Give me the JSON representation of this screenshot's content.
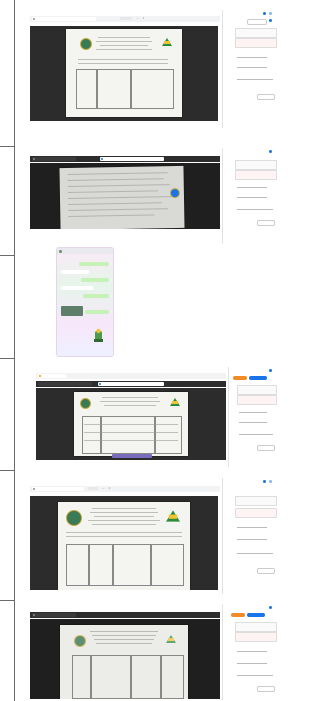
{
  "panels": [
    {
      "id": "p1",
      "title": "",
      "tab": "",
      "sidebar_button": ""
    },
    {
      "id": "p2",
      "title": "",
      "tab": "",
      "sidebar_button": ""
    },
    {
      "id": "p3",
      "title": "",
      "tab": "",
      "sidebar_button": ""
    },
    {
      "id": "p4",
      "title": "",
      "tab": "",
      "sidebar_button": ""
    },
    {
      "id": "p5",
      "title": "",
      "tab": "",
      "sidebar_button": ""
    },
    {
      "id": "p6",
      "title": "",
      "tab": "",
      "sidebar_button": ""
    }
  ],
  "colors": {
    "accent_blue": "#1a73e8",
    "viewer_dark": "#2c2c2c",
    "document_paper": "#f4f4f1",
    "divider": "#6a6a6a",
    "logo_green": "#2e8b3a",
    "logo_yellow": "#f1c232"
  },
  "icons": [
    "close-icon",
    "minimize-icon",
    "menu-icon",
    "user-avatar-icon",
    "seal-icon",
    "logo-icon",
    "sticker-icon",
    "cursor-icon"
  ]
}
